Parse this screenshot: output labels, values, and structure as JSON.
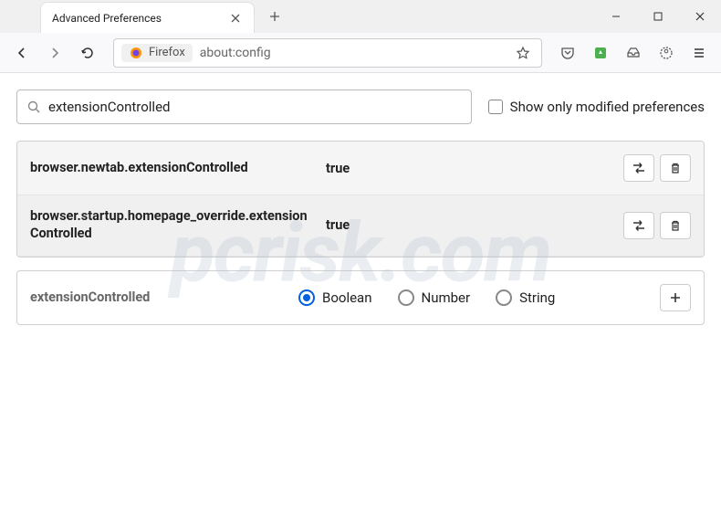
{
  "titlebar": {
    "tab_title": "Advanced Preferences"
  },
  "toolbar": {
    "identity_label": "Firefox",
    "url": "about:config"
  },
  "search": {
    "value": "extensionControlled",
    "show_modified_label": "Show only modified preferences"
  },
  "prefs": [
    {
      "name": "browser.newtab.extensionControlled",
      "value": "true"
    },
    {
      "name": "browser.startup.homepage_override.extensionControlled",
      "value": "true"
    }
  ],
  "new_pref": {
    "name": "extensionControlled",
    "types": [
      "Boolean",
      "Number",
      "String"
    ],
    "selected": 0
  },
  "watermark": "pcrisk.com"
}
